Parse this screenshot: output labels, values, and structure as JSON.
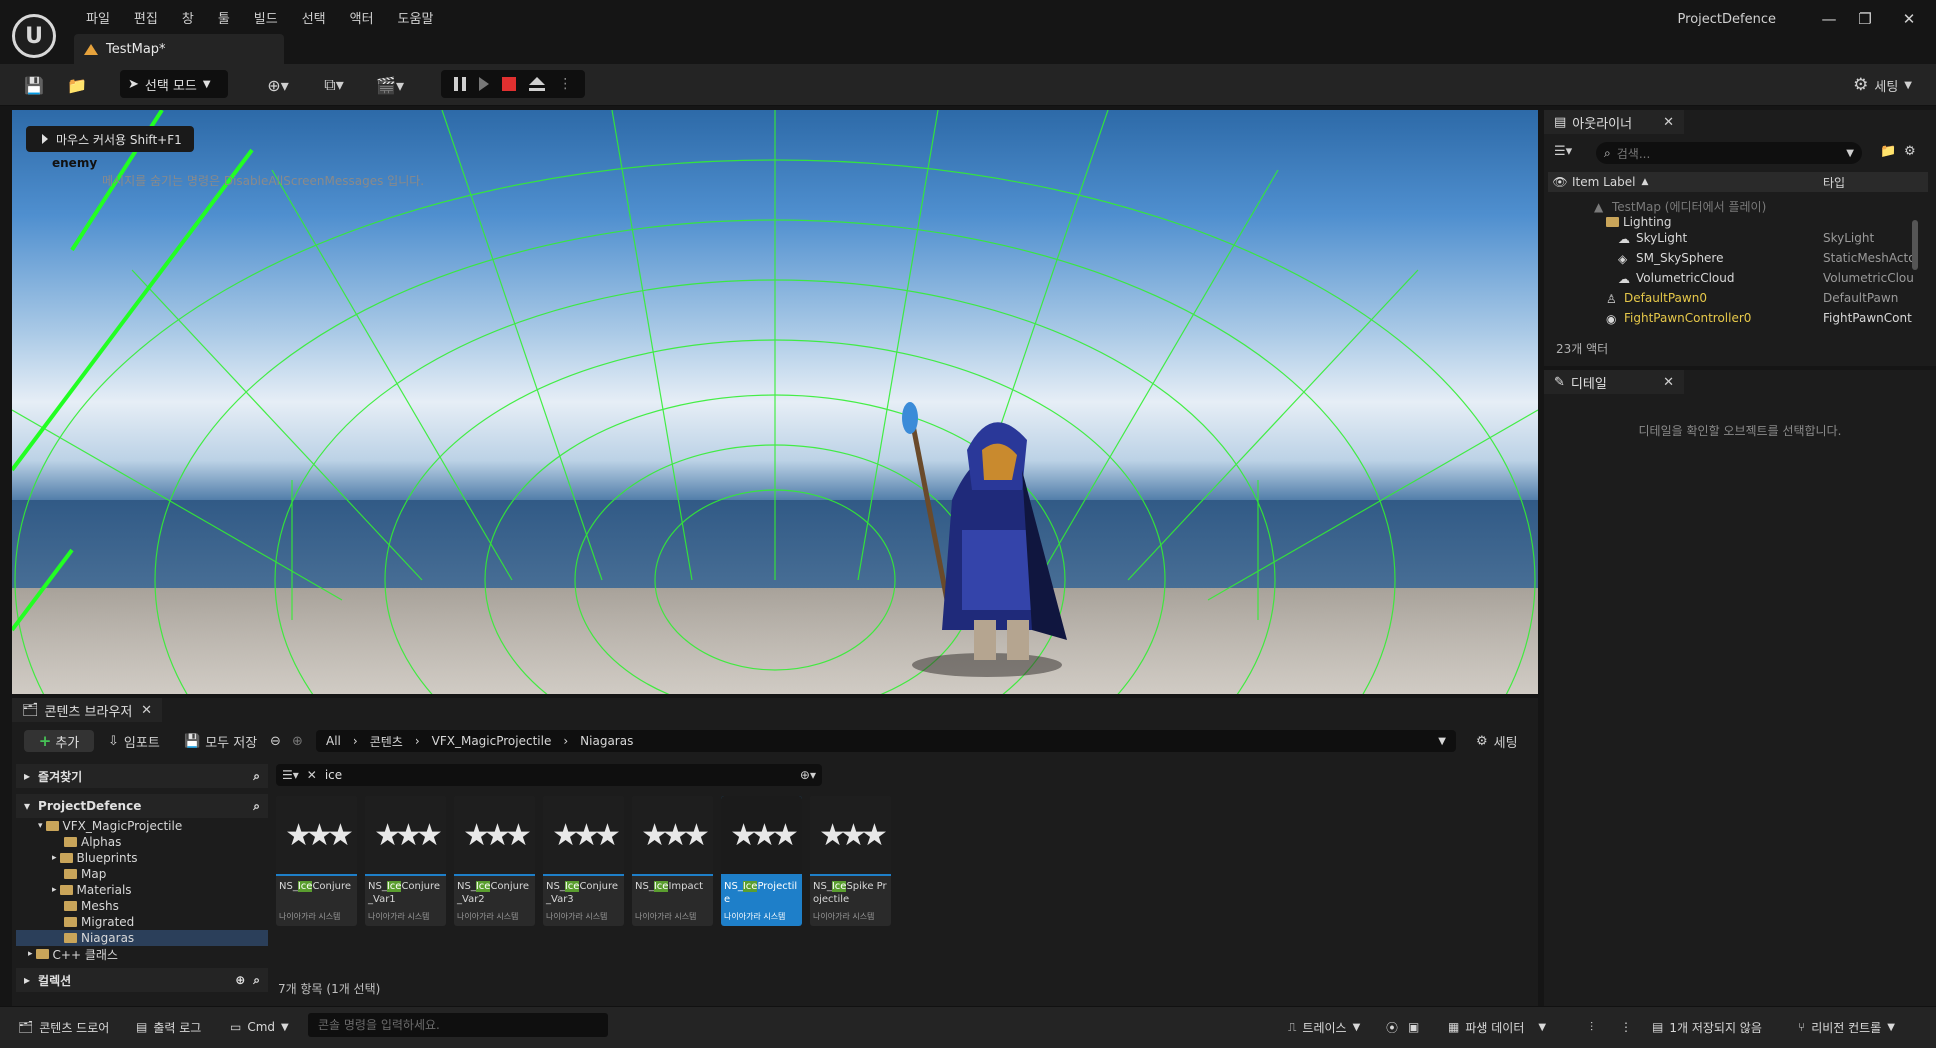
{
  "menu": [
    "파일",
    "편집",
    "창",
    "툴",
    "빌드",
    "선택",
    "액터",
    "도움말"
  ],
  "tab": {
    "title": "TestMap*"
  },
  "project_title": "ProjectDefence",
  "toolbar": {
    "mode_label": "선택 모드",
    "settings_label": "세팅"
  },
  "viewport": {
    "cursor_hint": "마우스 커서용 Shift+F1",
    "enemy_label": "enemy",
    "screen_message": "메시지를 숨기는 명령은 DisableAllScreenMessages 입니다."
  },
  "outliner": {
    "tab_label": "아웃라이너",
    "search_placeholder": "검색...",
    "col_label": "Item Label",
    "col_type": "타입",
    "rows": [
      {
        "name": "TestMap (에디터에서 플레이)",
        "type": ""
      },
      {
        "name": "Lighting",
        "type": ""
      },
      {
        "name": "SkyLight",
        "type": "SkyLight"
      },
      {
        "name": "SM_SkySphere",
        "type": "StaticMeshActo"
      },
      {
        "name": "VolumetricCloud",
        "type": "VolumetricClou"
      },
      {
        "name": "DefaultPawn0",
        "type": "DefaultPawn"
      },
      {
        "name": "FightPawnController0",
        "type": "FightPawnCont"
      }
    ],
    "actor_count": "23개 액터"
  },
  "details": {
    "tab_label": "디테일",
    "empty_text": "디테일을 확인할 오브젝트를 선택합니다."
  },
  "content_browser": {
    "tab_label": "콘텐츠 브라우저",
    "add_label": "추가",
    "import_label": "임포트",
    "save_all_label": "모두 저장",
    "breadcrumb": [
      "All",
      "콘텐츠",
      "VFX_MagicProjectile",
      "Niagaras"
    ],
    "settings_label": "세팅",
    "favorites_label": "즐겨찾기",
    "project_label": "ProjectDefence",
    "folders": [
      "VFX_MagicProjectile",
      "Alphas",
      "Blueprints",
      "Map",
      "Materials",
      "Meshs",
      "Migrated",
      "Niagaras",
      "C++ 클래스"
    ],
    "collection_label": "컬렉션",
    "filter_text": "ice",
    "assets": [
      {
        "pre": "NS_",
        "hl": "Ice",
        "post": "Conjure",
        "kind": "나이아가라 시스템"
      },
      {
        "pre": "NS_",
        "hl": "Ice",
        "post": "Conjure_Var1",
        "kind": "나이아가라 시스템"
      },
      {
        "pre": "NS_",
        "hl": "Ice",
        "post": "Conjure_Var2",
        "kind": "나이아가라 시스템"
      },
      {
        "pre": "NS_",
        "hl": "Ice",
        "post": "Conjure_Var3",
        "kind": "나이아가라 시스템"
      },
      {
        "pre": "NS_",
        "hl": "Ice",
        "post": "Impact",
        "kind": "나이아가라 시스템"
      },
      {
        "pre": "NS_",
        "hl": "Ice",
        "post": "Projectile",
        "kind": "나이아가라 시스템"
      },
      {
        "pre": "NS_",
        "hl": "Ice",
        "post": "Spike Projectile",
        "kind": "나이아가라 시스템"
      }
    ],
    "item_count": "7개 항목 (1개 선택)"
  },
  "statusbar": {
    "content_drawer": "콘텐츠 드로어",
    "output_log": "출력 로그",
    "cmd": "Cmd",
    "console_placeholder": "콘솔 명령을 입력하세요.",
    "trace": "트레이스",
    "derived_data": "파생 데이터",
    "unsaved": "1개 저장되지 않음",
    "revision": "리비전 컨트롤"
  },
  "colors": {
    "accent": "#1e7fc9",
    "grid_line": "#33ee33",
    "highlight": "#5a9e2f",
    "stop": "#e03030"
  }
}
